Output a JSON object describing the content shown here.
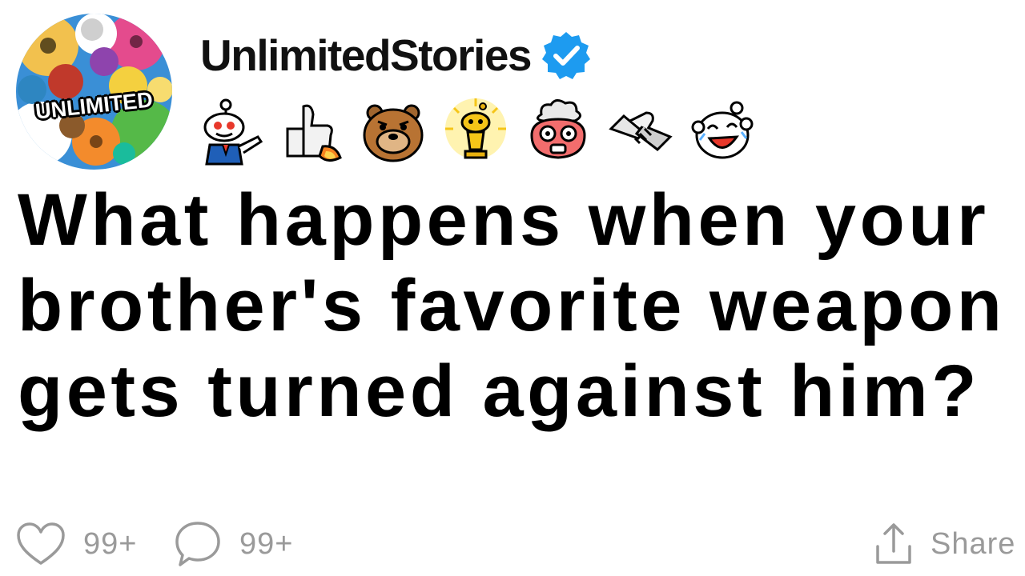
{
  "post": {
    "author": {
      "name": "UnlimitedStories",
      "verified": true,
      "avatar_label": "UNLIMITED"
    },
    "awards": [
      {
        "icon": "snoo-pointing-award-icon"
      },
      {
        "icon": "rocket-thumbs-up-award-icon"
      },
      {
        "icon": "bear-award-icon"
      },
      {
        "icon": "gold-trophy-snoo-award-icon"
      },
      {
        "icon": "mind-blown-award-icon"
      },
      {
        "icon": "handshake-award-icon"
      },
      {
        "icon": "laughing-snoo-award-icon"
      }
    ],
    "title": "What happens when your brother's favorite weapon gets turned against him?"
  },
  "footer": {
    "likes": "99+",
    "comments": "99+",
    "share_label": "Share"
  },
  "colors": {
    "verified": "#1d9bf0",
    "footer_text": "#9a9a9a",
    "title_text": "#000000"
  }
}
